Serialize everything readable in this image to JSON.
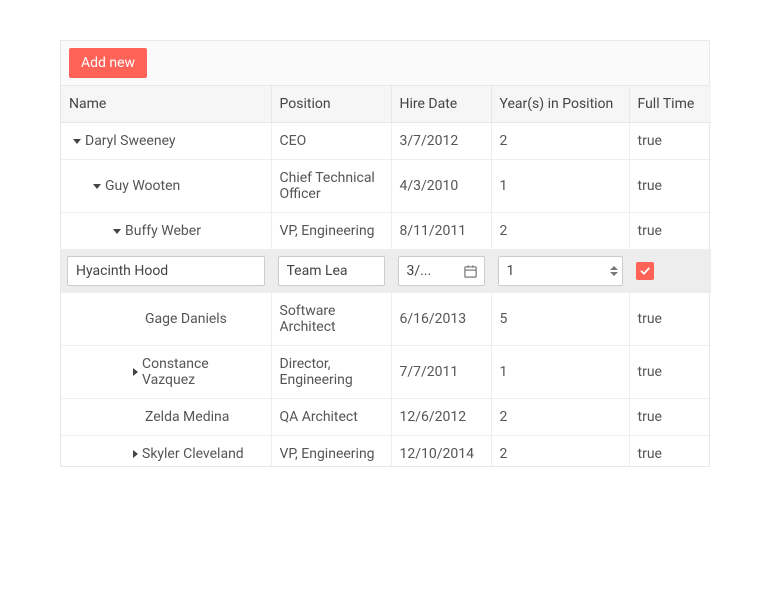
{
  "toolbar": {
    "add_label": "Add new"
  },
  "columns": {
    "name": "Name",
    "position": "Position",
    "hire_date": "Hire Date",
    "years": "Year(s) in Position",
    "full_time": "Full Time"
  },
  "rows": [
    {
      "indent": 0,
      "expander": "down",
      "name": "Daryl Sweeney",
      "position": "CEO",
      "hire_date": "3/7/2012",
      "years": "2",
      "full_time": "true"
    },
    {
      "indent": 1,
      "expander": "down",
      "name": "Guy Wooten",
      "position": "Chief Technical Officer",
      "hire_date": "4/3/2010",
      "years": "1",
      "full_time": "true"
    },
    {
      "indent": 2,
      "expander": "down",
      "name": "Buffy Weber",
      "position": "VP, Engineering",
      "hire_date": "8/11/2011",
      "years": "2",
      "full_time": "true"
    },
    {
      "indent": 0,
      "editing": true,
      "name": "Hyacinth Hood",
      "position": "Team Lea",
      "hire_date": "3/...",
      "years": "1",
      "full_time_checked": true
    },
    {
      "indent": 3,
      "expander": "none",
      "name": "Gage Daniels",
      "position": "Software Architect",
      "hire_date": "6/16/2013",
      "years": "5",
      "full_time": "true"
    },
    {
      "indent": 3,
      "expander": "right",
      "name": "Constance Vazquez",
      "position": "Director, Engineering",
      "hire_date": "7/7/2011",
      "years": "1",
      "full_time": "true"
    },
    {
      "indent": 3,
      "expander": "none",
      "name": "Zelda Medina",
      "position": "QA Architect",
      "hire_date": "12/6/2012",
      "years": "2",
      "full_time": "true"
    },
    {
      "indent": 3,
      "expander": "right",
      "name": "Skyler Cleveland",
      "position": "VP, Engineering",
      "hire_date": "12/10/2014",
      "years": "2",
      "full_time": "true"
    }
  ]
}
